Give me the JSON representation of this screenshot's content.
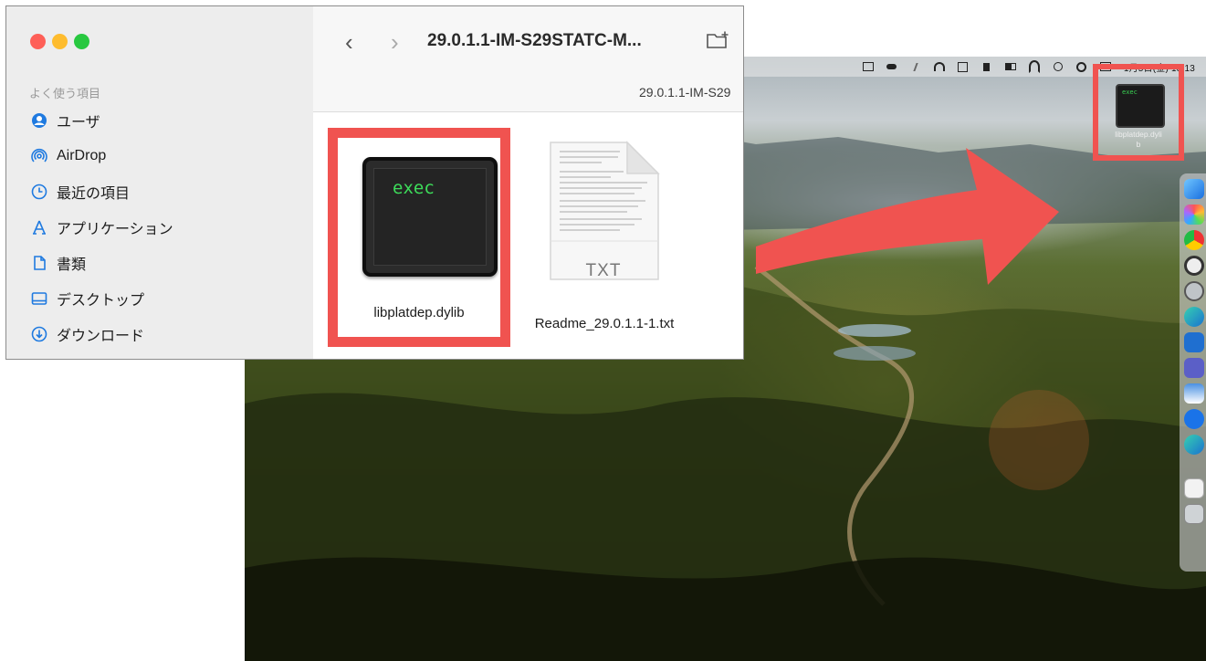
{
  "finder": {
    "sidebar": {
      "heading": "よく使う項目",
      "items": [
        {
          "label": "ユーザ",
          "icon": "user-circle-icon"
        },
        {
          "label": "AirDrop",
          "icon": "airdrop-icon"
        },
        {
          "label": "最近の項目",
          "icon": "clock-icon"
        },
        {
          "label": "アプリケーション",
          "icon": "applications-icon"
        },
        {
          "label": "書類",
          "icon": "document-icon"
        },
        {
          "label": "デスクトップ",
          "icon": "desktop-icon"
        },
        {
          "label": "ダウンロード",
          "icon": "download-icon"
        }
      ]
    },
    "toolbar": {
      "back": "‹",
      "forward": "›",
      "title": "29.0.1.1-IM-S29STATC-M...",
      "path": "29.0.1.1-IM-S29"
    },
    "files": [
      {
        "name": "libplatdep.dylib",
        "icon_text": "exec",
        "highlighted": true
      },
      {
        "name": "Readme_29.0.1.1-1.txt",
        "icon_text": "TXT",
        "highlighted": false
      }
    ]
  },
  "desktop": {
    "menubar": {
      "date_text": "1月5日(金) 18:13"
    },
    "file": {
      "name_line1": "libplatdep.dyli",
      "name_line2": "b",
      "icon_text": "exec"
    }
  },
  "colors": {
    "highlight": "#f05350",
    "exec_text": "#3ddc5a",
    "traffic_red": "#fe5f57",
    "traffic_yellow": "#febc2e",
    "traffic_green": "#28c840"
  }
}
